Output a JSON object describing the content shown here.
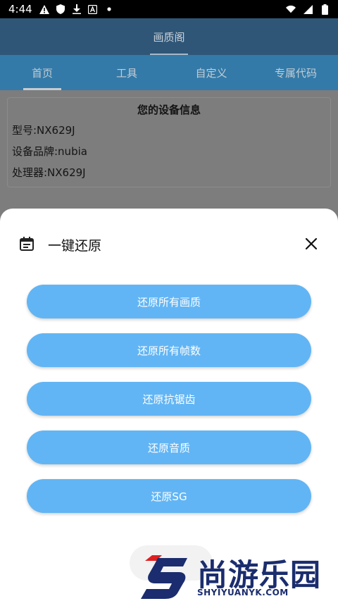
{
  "status_bar": {
    "time": "4:44",
    "left_icons": [
      "alert-icon",
      "shield-icon",
      "download-icon",
      "font-icon",
      "dot-icon"
    ],
    "right_icons": [
      "wifi-icon",
      "signal-icon",
      "battery-icon"
    ]
  },
  "app": {
    "title": "画质阁"
  },
  "tabs": [
    {
      "label": "首页",
      "active": true
    },
    {
      "label": "工具",
      "active": false
    },
    {
      "label": "自定义",
      "active": false
    },
    {
      "label": "专属代码",
      "active": false
    }
  ],
  "device_info": {
    "title": "您的设备信息",
    "model": "型号:NX629J",
    "brand": "设备品牌:nubia",
    "processor": "处理器:NX629J"
  },
  "sheet": {
    "title": "一键还原",
    "icon": "calendar-icon",
    "close_icon": "close-icon",
    "buttons": [
      {
        "label": "还原所有画质"
      },
      {
        "label": "还原所有帧数"
      },
      {
        "label": "还原抗锯齿"
      },
      {
        "label": "还原音质"
      },
      {
        "label": "还原SG"
      }
    ]
  },
  "watermark": {
    "text": "尚游乐园",
    "url": "SHYIYUANYK.COM"
  },
  "colors": {
    "appbar": "#2f5677",
    "tabs": "#337aa8",
    "button": "#62b5f4",
    "watermark": "#1b2d6e",
    "watermark_accent": "#e02020"
  }
}
